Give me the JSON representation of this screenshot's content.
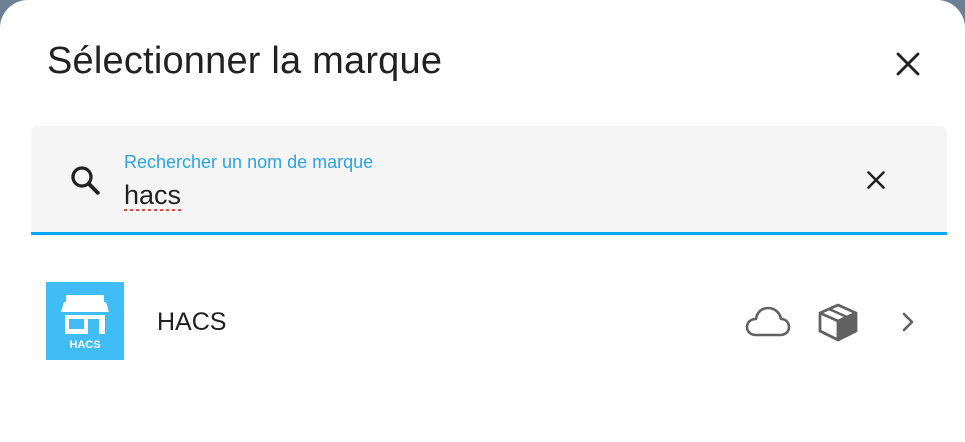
{
  "dialog": {
    "title": "Sélectionner la marque",
    "close_icon": "close-icon"
  },
  "search": {
    "label": "Rechercher un nom de marque",
    "value": "hacs",
    "search_icon": "magnify-icon",
    "clear_icon": "close-icon"
  },
  "results": [
    {
      "name": "HACS",
      "logo_text": "HACS",
      "logo_color": "#41bdf5",
      "badges": [
        "cloud-outline-icon",
        "package-variant-icon"
      ],
      "trailing_icon": "chevron-right-icon"
    }
  ],
  "colors": {
    "accent": "#03a9f4",
    "label": "#2aa4e3",
    "text": "#212121",
    "search_background": "#f5f5f5"
  }
}
